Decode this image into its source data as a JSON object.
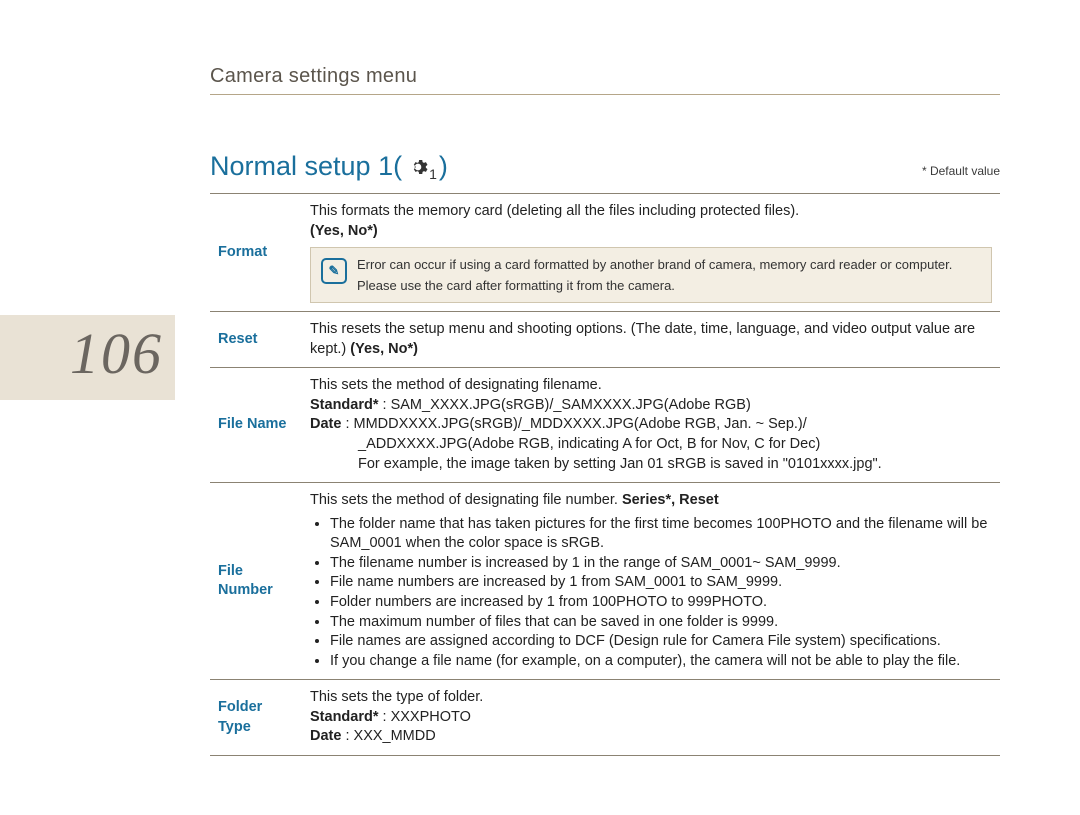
{
  "page_number": "106",
  "breadcrumb": "Camera settings menu",
  "section": {
    "title": "Normal setup 1(",
    "title_after": ")",
    "gear_sub": "1",
    "default_note": "* Default value"
  },
  "rows": {
    "format": {
      "label": "Format",
      "desc": "This formats the memory card (deleting all the files including protected files).",
      "options": "(Yes, No*)",
      "note_line1": "Error can occur if using a card formatted by another brand of camera, memory card reader or computer.",
      "note_line2": "Please use the card after formatting it from the camera."
    },
    "reset": {
      "label": "Reset",
      "desc_a": "This resets the setup menu and shooting options. (The date, time, language, and video output value are kept.) ",
      "options": "(Yes, No*)"
    },
    "filename": {
      "label": "File Name",
      "line1": "This sets the method of designating filename.",
      "std_label": "Standard*",
      "std_value": " : SAM_XXXX.JPG(sRGB)/_SAMXXXX.JPG(Adobe RGB)",
      "date_label": "Date",
      "date_value": " : MMDDXXXX.JPG(sRGB)/_MDDXXXX.JPG(Adobe RGB, Jan. ~ Sep.)/",
      "date_value2": "_ADDXXXX.JPG(Adobe RGB,  indicating A for Oct, B for Nov, C for Dec)",
      "example": "For example, the image taken by setting Jan 01 sRGB is saved in \"0101xxxx.jpg\"."
    },
    "filenumber": {
      "label_a": "File",
      "label_b": "Number",
      "intro_a": "This sets the method of designating file number. ",
      "intro_b": "Series*, Reset",
      "bullet1": "The folder name that has taken pictures for the first time becomes 100PHOTO and the filename will be SAM_0001 when the color space is sRGB.",
      "bullet2": "The filename number is increased by 1 in the range of SAM_0001~ SAM_9999.",
      "bullet3": "File name numbers are increased by 1 from SAM_0001 to SAM_9999.",
      "bullet4": "Folder numbers are increased by 1 from 100PHOTO to 999PHOTO.",
      "bullet5": "The maximum number of files that can be saved in one folder is 9999.",
      "bullet6": "File names are assigned according to DCF (Design rule for Camera File system) specifications.",
      "bullet7": "If you change a file name (for example, on a computer), the camera will not be able to play the file."
    },
    "foldertype": {
      "label_a": "Folder",
      "label_b": "Type",
      "line1": "This sets the type of folder.",
      "std_label": "Standard*",
      "std_value": " : XXXPHOTO",
      "date_label": "Date",
      "date_value": " : XXX_MMDD"
    }
  }
}
